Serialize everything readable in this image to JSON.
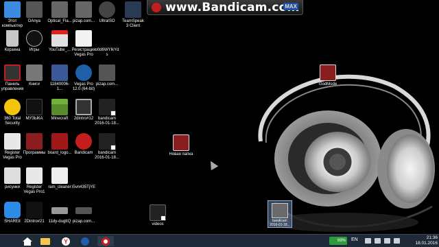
{
  "desktop": {
    "icons": [
      {
        "label": "Этот компьютер"
      },
      {
        "label": "DAnya"
      },
      {
        "label": "Optical_Fla..."
      },
      {
        "label": "pizap.com..."
      },
      {
        "label": "UltraISO"
      },
      {
        "label": "TeamSpeak 3 Client"
      },
      {
        "label": "Корзина"
      },
      {
        "label": "Игры"
      },
      {
        "label": "YouTube_..."
      },
      {
        "label": "Регистрация Vegas Pro"
      },
      {
        "label": "o0d6WYIkYds"
      },
      {
        "label": "Панель управления"
      },
      {
        "label": "Книги"
      },
      {
        "label": "11840006-1..."
      },
      {
        "label": "Vegas Pro 12.0 (64-bit)"
      },
      {
        "label": "pizap.com..."
      },
      {
        "label": "360 Total Security"
      },
      {
        "label": "МУЗЫКА"
      },
      {
        "label": "Minecraft"
      },
      {
        "label": "2dintro#12"
      },
      {
        "label": "bandicam 2016-01-18..."
      },
      {
        "label": "Register Vegas Pro"
      },
      {
        "label": "Программы"
      },
      {
        "label": "board_logo..."
      },
      {
        "label": "Bandicam"
      },
      {
        "label": "bandicam 2016-01-18..."
      },
      {
        "label": "рисунки"
      },
      {
        "label": "Register Vegas Pro1"
      },
      {
        "label": "ram_cleaner"
      },
      {
        "label": "I5vn435TjYE"
      },
      {
        "label": "SHAREit"
      },
      {
        "label": "2Dintro#21"
      },
      {
        "label": "11dy-dugttQ"
      },
      {
        "label": "pizap.com..."
      },
      {
        "label": "Новая папка"
      },
      {
        "label": "GodMode"
      },
      {
        "label": "videos"
      }
    ],
    "dragged_item_label": "bandicam 2016-01-18..."
  },
  "recording_bar": {
    "brand": "www.Bandicam.com",
    "badge": "MAX"
  },
  "taskbar": {
    "battery_text": "69%",
    "language": "EN",
    "time": "21:36",
    "date": "18.01.2016"
  },
  "colors": {
    "taskbar_bg": "#1e2a38",
    "battery": "#2e9a3d",
    "bandicam_red": "#c41e1e"
  }
}
